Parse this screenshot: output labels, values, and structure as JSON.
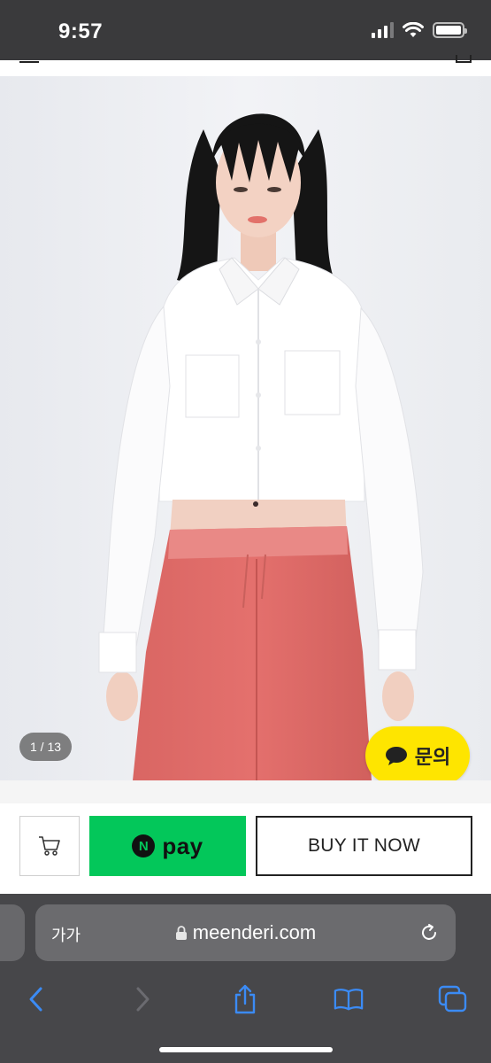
{
  "status_bar": {
    "time": "9:57"
  },
  "product": {
    "image_counter": "1 / 13",
    "inquiry_label": "문의",
    "colors": {
      "background": "#eef0f3",
      "shirt": "#ffffff",
      "pants": "#e4706d",
      "hair": "#151515"
    }
  },
  "purchase_bar": {
    "npay_mark": "N",
    "npay_label": "pay",
    "buy_label": "BUY IT NOW",
    "colors": {
      "npay": "#03c75a",
      "inquiry": "#fee500"
    }
  },
  "browser": {
    "text_size_label": "가가",
    "url": "meenderi.com",
    "icons": [
      "lock-icon",
      "reload-icon",
      "back-icon",
      "forward-icon",
      "share-icon",
      "bookmarks-icon",
      "tabs-icon"
    ]
  }
}
